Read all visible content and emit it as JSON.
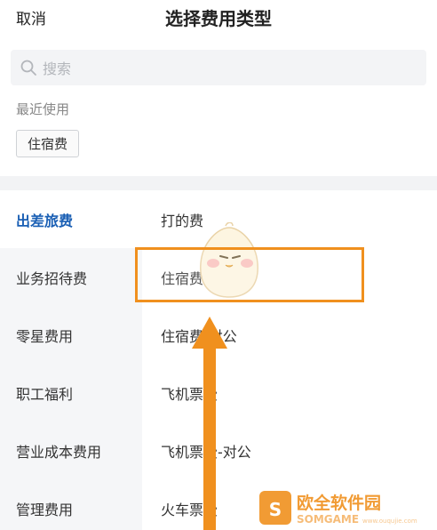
{
  "header": {
    "cancel_label": "取消",
    "title": "选择费用类型"
  },
  "search": {
    "placeholder": "搜索",
    "icon": "search-icon"
  },
  "recent": {
    "label": "最近使用",
    "tags": [
      "住宿费"
    ]
  },
  "sidebar": {
    "active_color": "#1a5fb4",
    "items": [
      {
        "label": "出差旅费",
        "active": true
      },
      {
        "label": "业务招待费",
        "active": false
      },
      {
        "label": "零星费用",
        "active": false
      },
      {
        "label": "职工福利",
        "active": false
      },
      {
        "label": "营业成本费用",
        "active": false
      },
      {
        "label": "管理费用",
        "active": false
      }
    ]
  },
  "content": {
    "items": [
      {
        "label": "打的费"
      },
      {
        "label": "住宿费"
      },
      {
        "label": "住宿费-对公"
      },
      {
        "label": "飞机票费"
      },
      {
        "label": "飞机票费-对公"
      },
      {
        "label": "火车票费"
      }
    ]
  },
  "annotation": {
    "highlight_color": "#f0901e",
    "arrow_color": "#f0901e",
    "mascot_icon": "chick-mascot-icon"
  },
  "watermark": {
    "text": "欧全软件园",
    "subtext": "SOMGAME",
    "url_text": "www.ouqujie.com",
    "logo_icon": "watermark-logo-icon"
  }
}
